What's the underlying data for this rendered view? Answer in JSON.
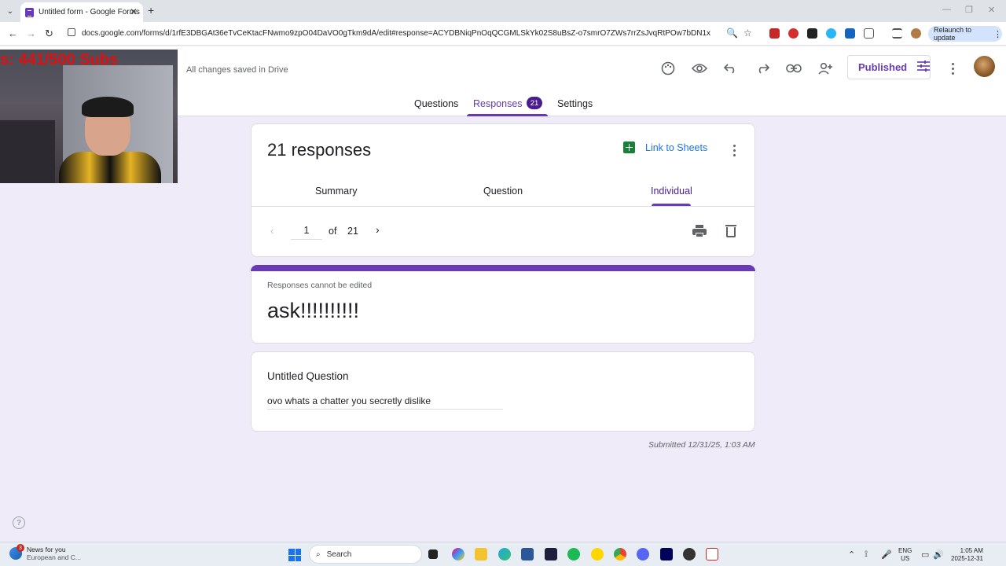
{
  "browser": {
    "tab_title": "Untitled form - Google Forms",
    "tab_close": "✕",
    "new_tab": "+",
    "url": "docs.google.com/forms/d/1rfE3DBGAt36eTvCeKtacFNwmo9zpO04DaVO0gTkm9dA/edit#response=ACYDBNiqPnOqQCGMLSkYk02S8uBsZ-o7smrO7ZWs7rrZsJvqRtPOw7bDN1xoSox8s5J6hKA",
    "relaunch_label": "Relaunch to update",
    "icons": {
      "back": "←",
      "forward": "→",
      "reload": "↻",
      "zoom": "🔍",
      "star": "☆",
      "menu": "⋮",
      "minimize": "—",
      "restore": "❐",
      "close": "✕",
      "tab_list": "⌄"
    }
  },
  "webcam": {
    "overlay_text": "s: 441/500  Subs"
  },
  "forms_header": {
    "saved_status": "All changes saved in Drive",
    "published_label": "Published",
    "tabs": [
      {
        "label": "Questions"
      },
      {
        "label": "Responses"
      },
      {
        "label": "Settings"
      }
    ],
    "responses_count": "21",
    "icons": {
      "palette": "🎨",
      "preview": "👁",
      "undo": "↶",
      "redo": "↷",
      "link": "🔗",
      "add_collaborator": "👤+",
      "tune": "⚟"
    }
  },
  "summary_card": {
    "title": "21 responses",
    "link_to_sheets": "Link to Sheets",
    "subtabs": [
      {
        "label": "Summary"
      },
      {
        "label": "Question"
      },
      {
        "label": "Individual"
      }
    ],
    "pager": {
      "prev": "‹",
      "current": "1",
      "of_label": "of",
      "total": "21",
      "next": "›"
    }
  },
  "title_card": {
    "notice": "Responses cannot be edited",
    "form_title": "ask!!!!!!!!!!"
  },
  "question_card": {
    "question": "Untitled Question",
    "answer": "ovo whats a chatter you secretly dislike"
  },
  "submitted": "Submitted 12/31/25, 1:03 AM",
  "help_icon": "?",
  "taskbar": {
    "news_title": "News for you",
    "news_sub": "European and C...",
    "news_badge": "3",
    "search_label": "Search",
    "search_icon": "⌕",
    "language_line1": "ENG",
    "language_line2": "US",
    "time": "1:05 AM",
    "date": "2025-12-31",
    "tray_icons": {
      "chevron": "⌃",
      "wifi": "⟟",
      "volume": "🔊"
    }
  },
  "colors": {
    "accent": "#673ab7",
    "page_bg": "#f0ebf8",
    "link_blue": "#1a73e8",
    "sheets_green": "#188038"
  }
}
